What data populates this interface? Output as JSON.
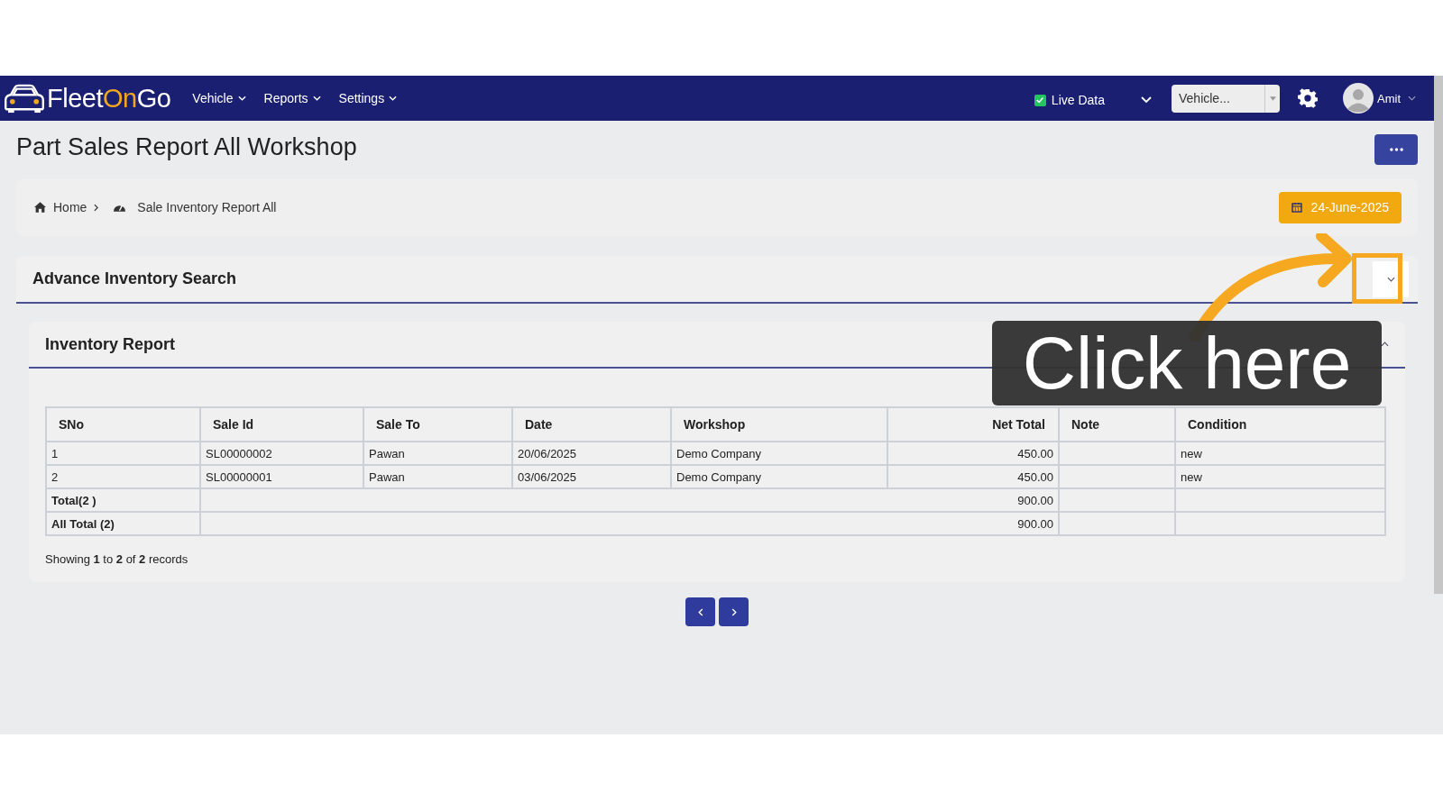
{
  "navbar": {
    "logo": {
      "part1": "Fleet",
      "part2": "On",
      "part3": "Go"
    },
    "menus": [
      {
        "label": "Vehicle"
      },
      {
        "label": "Reports"
      },
      {
        "label": "Settings"
      }
    ],
    "live_data": {
      "label": "Live Data",
      "checked": true
    },
    "vehicle_select": {
      "value": "Vehicle..."
    },
    "user": {
      "name": "Amit"
    }
  },
  "page": {
    "title": "Part Sales Report All Workshop"
  },
  "breadcrumb": {
    "items": [
      {
        "label": "Home"
      },
      {
        "label": "Sale Inventory Report All"
      }
    ],
    "date": "24-June-2025"
  },
  "search_panel": {
    "title": "Advance Inventory Search",
    "expanded": false
  },
  "report": {
    "title": "Inventory Report",
    "columns": [
      "SNo",
      "Sale Id",
      "Sale To",
      "Date",
      "Workshop",
      "Net Total",
      "Note",
      "Condition"
    ],
    "rows": [
      [
        "1",
        "SL00000002",
        "Pawan",
        "20/06/2025",
        "Demo Company",
        "450.00",
        "",
        "new"
      ],
      [
        "2",
        "SL00000001",
        "Pawan",
        "03/06/2025",
        "Demo Company",
        "450.00",
        "",
        "new"
      ]
    ],
    "totals": [
      {
        "label": "Total(2 )",
        "net_total": "900.00"
      },
      {
        "label": "All Total (2)",
        "net_total": "900.00"
      }
    ],
    "summary": "Showing **1** to **2** of **2** records"
  },
  "annotation": {
    "text": "Click here"
  }
}
